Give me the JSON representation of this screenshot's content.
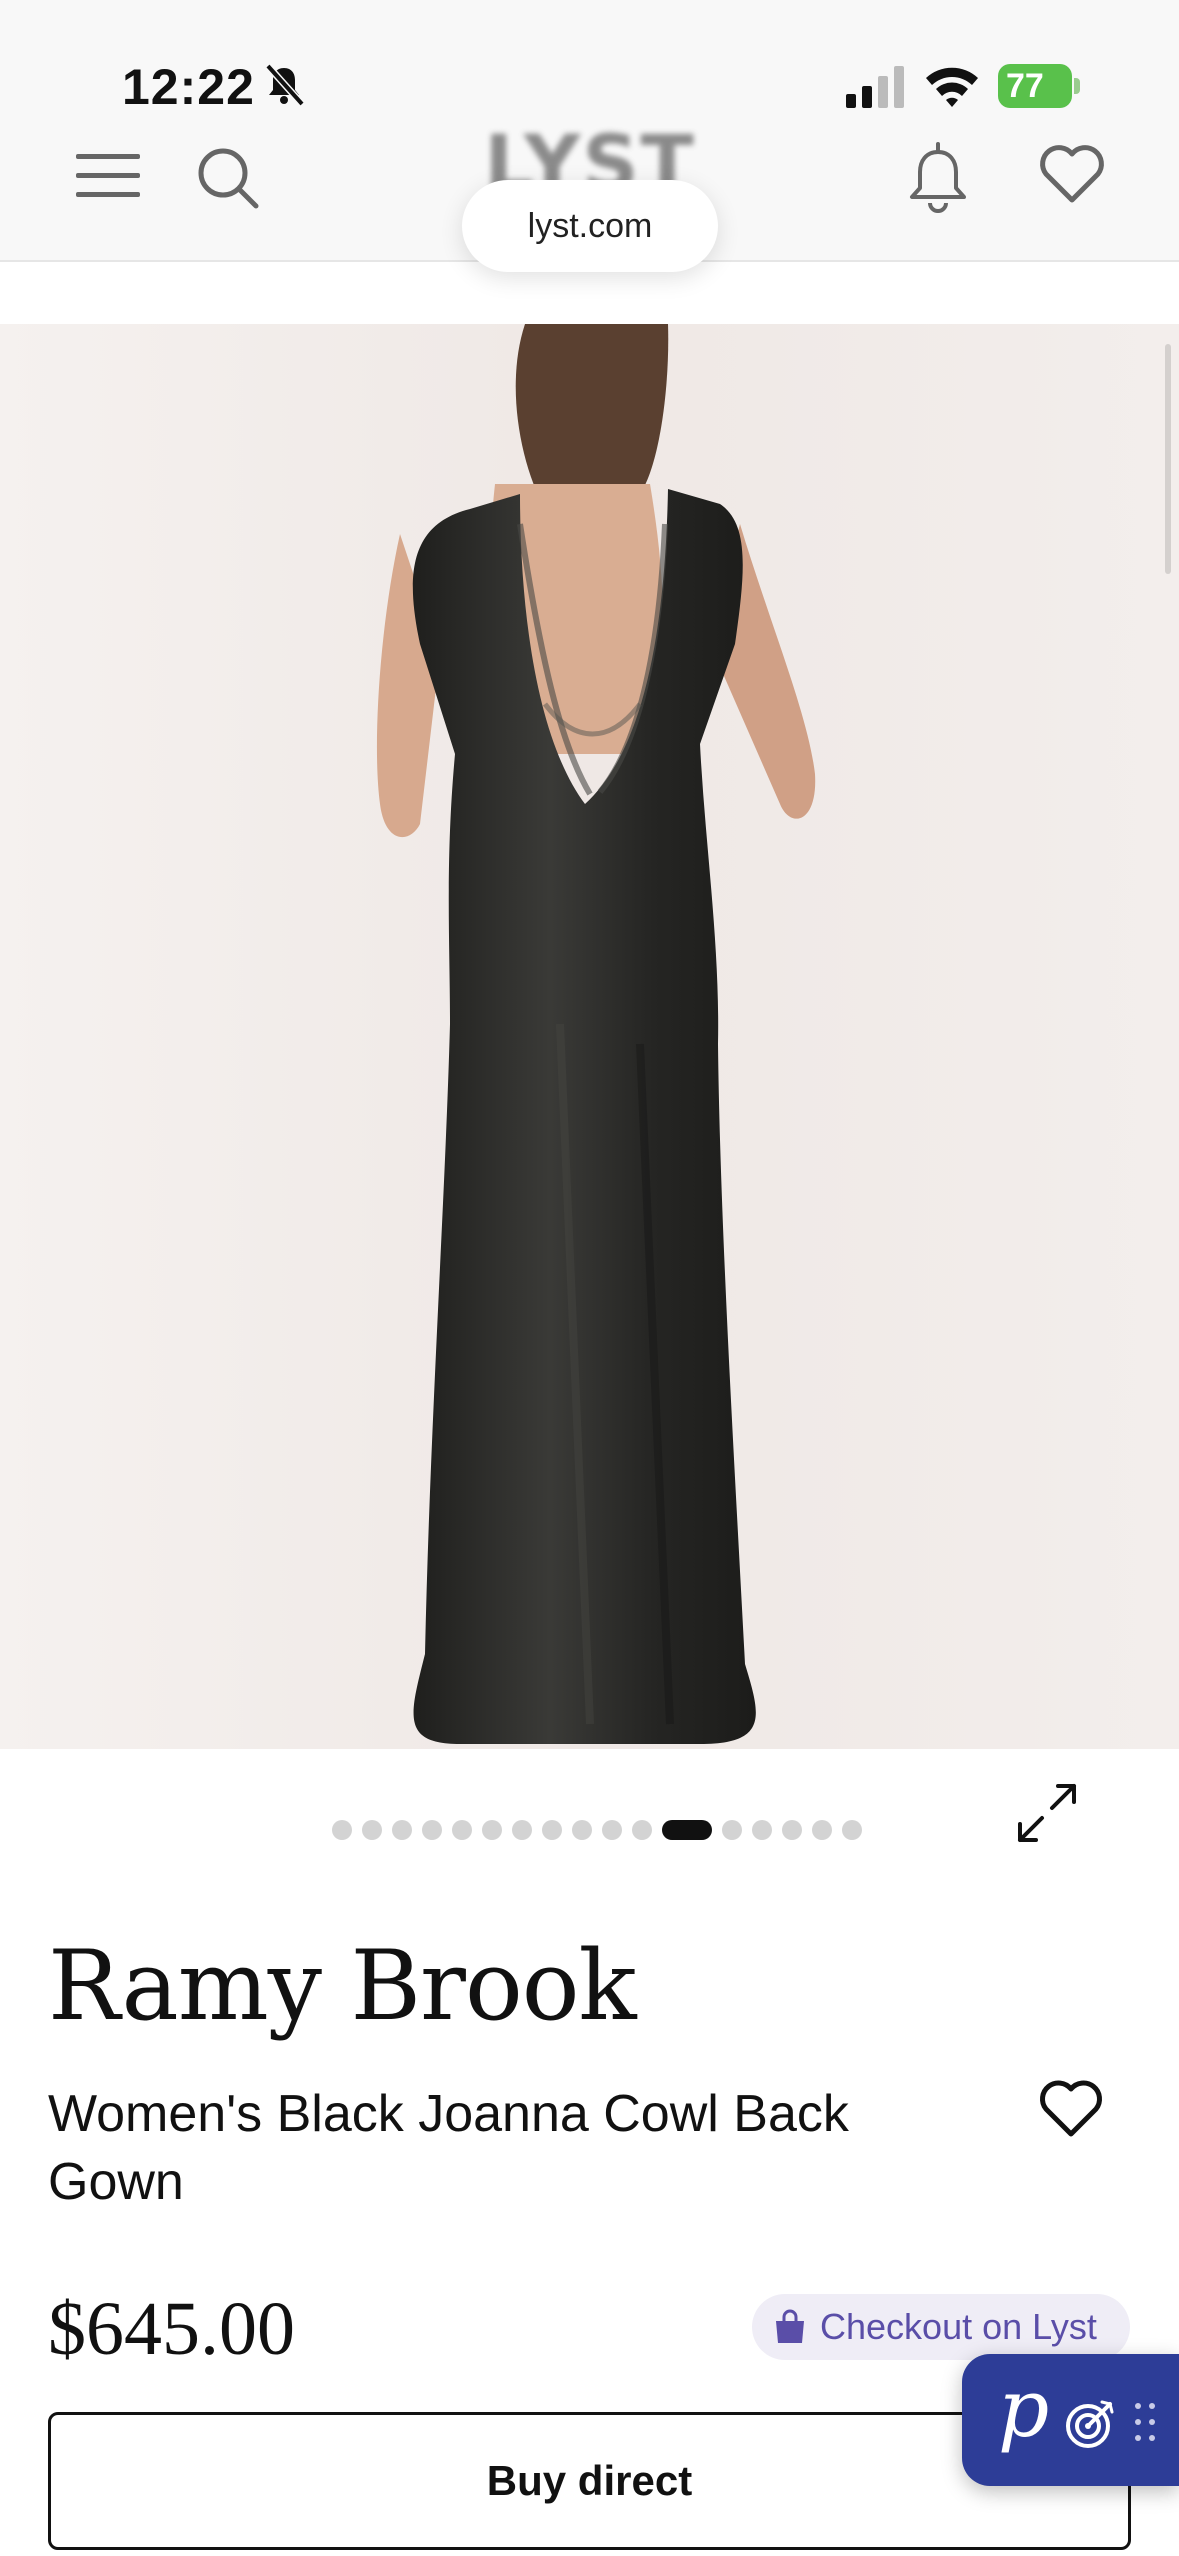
{
  "status_bar": {
    "time": "12:22",
    "battery": "77"
  },
  "header": {
    "logo": "LYST",
    "url": "lyst.com"
  },
  "carousel": {
    "total": 17,
    "active_index": 11
  },
  "product": {
    "brand": "Ramy Brook",
    "name": "Women's Black Joanna Cowl Back Gown",
    "price": "$645.00",
    "checkout_label": "Checkout on Lyst",
    "buy_label": "Buy direct"
  },
  "widget": {
    "letter": "p"
  },
  "colors": {
    "accent_purple": "#5a4ea8",
    "widget_blue": "#2d3d97",
    "battery_green": "#59c14b",
    "image_background": "#f1ecea",
    "dress": "#2a2a28"
  }
}
